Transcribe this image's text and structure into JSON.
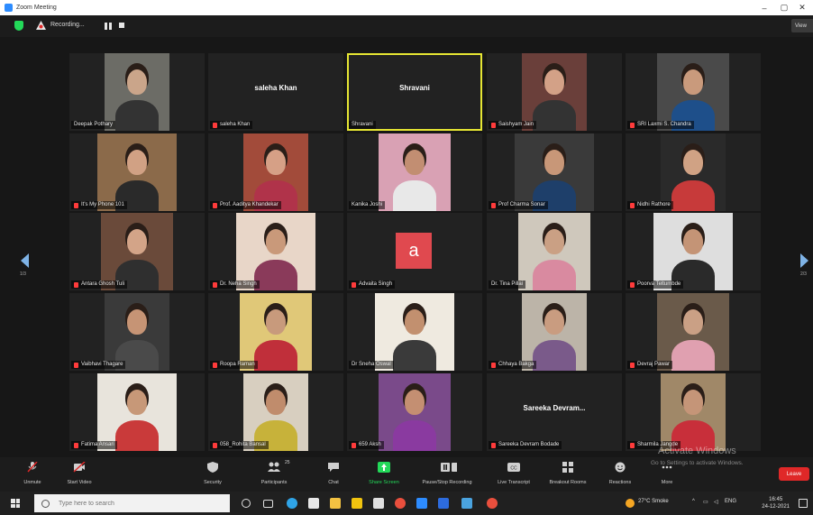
{
  "window": {
    "title": "Zoom Meeting",
    "minimize": "–",
    "maximize": "▢",
    "close": "✕"
  },
  "top_strip": {
    "recording_label": "Recording...",
    "view_label": "View"
  },
  "gallery": {
    "page_indicator_left": "1/3",
    "page_indicator_right": "2/3",
    "tiles": [
      {
        "name": "Deepak Pothary",
        "muted": false,
        "type": "video"
      },
      {
        "name": "saleha Khan",
        "muted": true,
        "type": "name",
        "center_label": "saleha Khan"
      },
      {
        "name": "Shravani",
        "muted": false,
        "type": "name",
        "center_label": "Shravani",
        "active": true
      },
      {
        "name": "Saishyam Jain",
        "muted": true,
        "type": "video"
      },
      {
        "name": "SRI Laxmi S. Chandra",
        "muted": true,
        "type": "video"
      },
      {
        "name": "It's My Phone 101",
        "muted": true,
        "type": "video"
      },
      {
        "name": "Prof. Aaditya Khandekar",
        "muted": true,
        "type": "video"
      },
      {
        "name": "Kanika Joshi",
        "muted": false,
        "type": "video"
      },
      {
        "name": "Prof Charma Sonar",
        "muted": true,
        "type": "video"
      },
      {
        "name": "Nidhi Rathore",
        "muted": true,
        "type": "video"
      },
      {
        "name": "Antara Ghosh Tuli",
        "muted": true,
        "type": "video"
      },
      {
        "name": "Dr. Neha Singh",
        "muted": true,
        "type": "video"
      },
      {
        "name": "Advaita Singh",
        "muted": true,
        "type": "avatar",
        "avatar_letter": "a"
      },
      {
        "name": "Dr. Tina Pillai",
        "muted": false,
        "type": "video"
      },
      {
        "name": "Poorva Teltumbde",
        "muted": true,
        "type": "video"
      },
      {
        "name": "Vaibhavi Thagare",
        "muted": true,
        "type": "video"
      },
      {
        "name": "Roopa Raman",
        "muted": true,
        "type": "video"
      },
      {
        "name": "Dr Sneha Oswal",
        "muted": false,
        "type": "video"
      },
      {
        "name": "Chhaya Bakga",
        "muted": true,
        "type": "video"
      },
      {
        "name": "Devraj Pawar",
        "muted": true,
        "type": "video"
      },
      {
        "name": "Fatima Ansari",
        "muted": true,
        "type": "video"
      },
      {
        "name": "058_Rohita Bansal",
        "muted": true,
        "type": "video"
      },
      {
        "name": "659 Aksh",
        "muted": true,
        "type": "video"
      },
      {
        "name": "Sareeka Devram Bodade",
        "muted": true,
        "type": "name",
        "center_label": "Sareeka  Devram..."
      },
      {
        "name": "Sharmila Jangde",
        "muted": true,
        "type": "video"
      }
    ]
  },
  "toolbar": {
    "unmute": "Unmute",
    "start_video": "Start Video",
    "security": "Security",
    "participants": "Participants",
    "participants_count": "25",
    "chat": "Chat",
    "share_screen": "Share Screen",
    "pause_stop_recording": "Pause/Stop Recording",
    "live_transcript": "Live Transcript",
    "breakout_rooms": "Breakout Rooms",
    "reactions": "Reactions",
    "more": "More",
    "leave": "Leave"
  },
  "watermark": {
    "line1": "Activate Windows",
    "line2": "Go to Settings to activate Windows."
  },
  "taskbar": {
    "search_placeholder": "Type here to search",
    "weather": "27°C  Smoke",
    "lang": "ENG",
    "time": "16:45",
    "date": "24-12-2021"
  },
  "colors": {
    "accent_green": "#23d959",
    "leave_red": "#e02828",
    "active_speaker": "#e6e633",
    "avatar_red": "#e0494f"
  }
}
